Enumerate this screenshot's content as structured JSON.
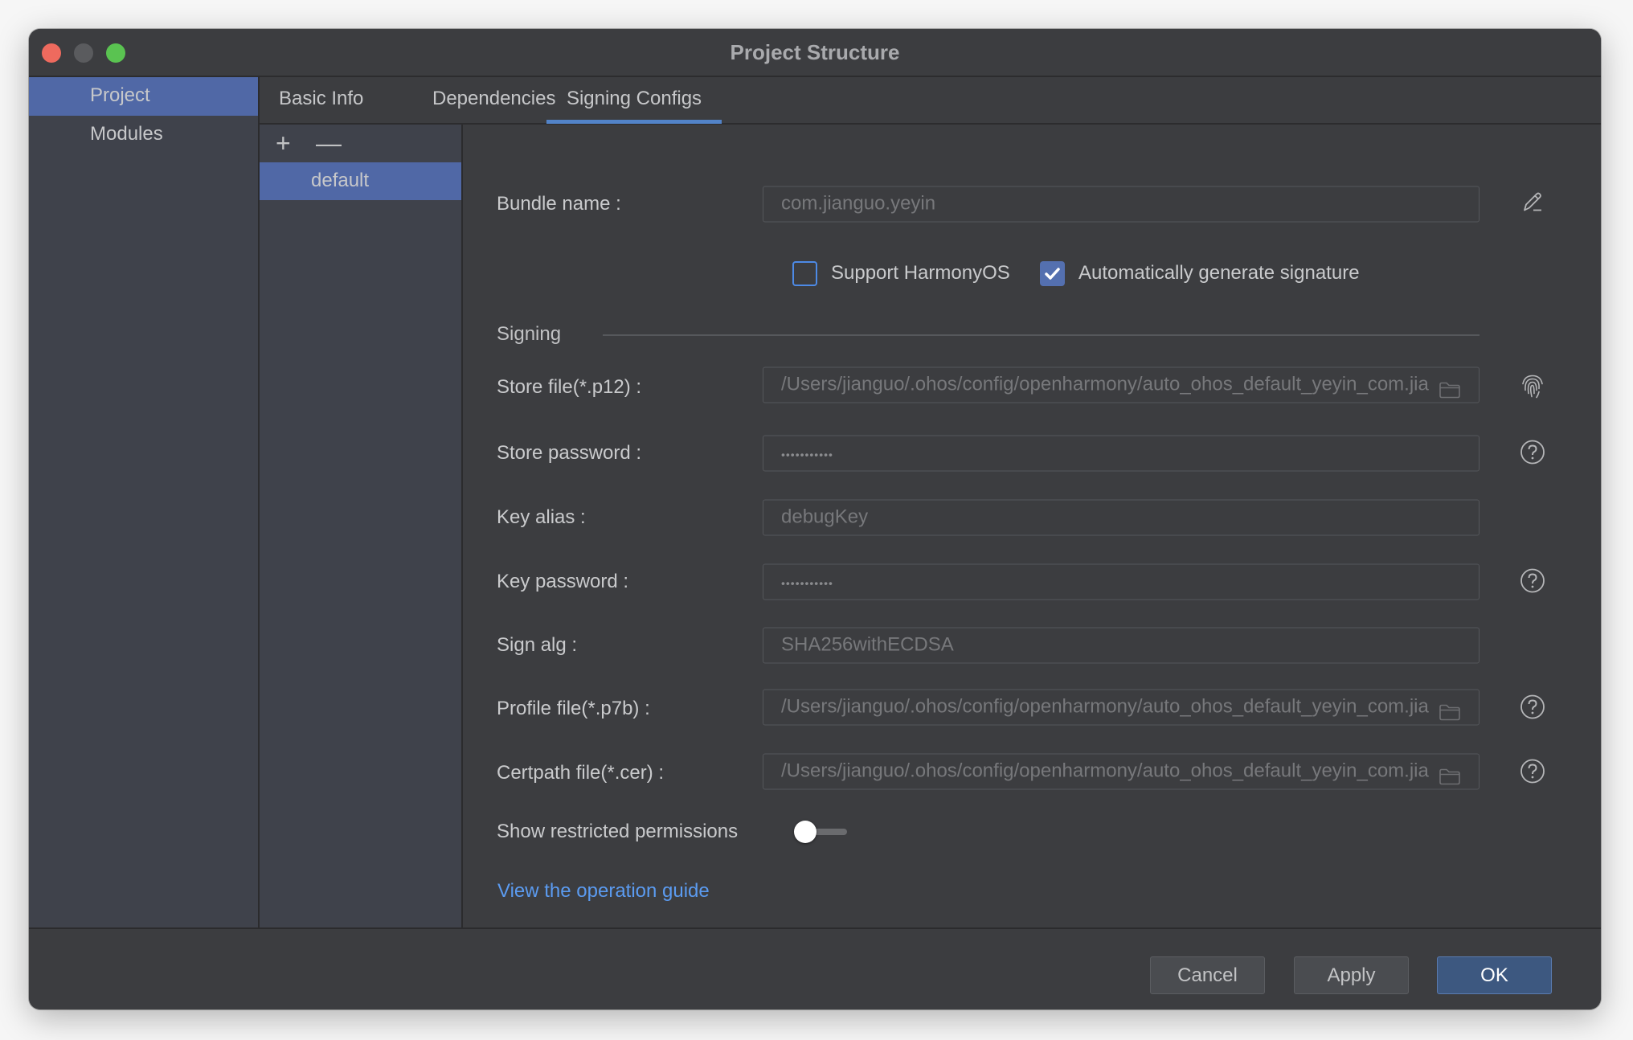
{
  "window": {
    "title": "Project Structure",
    "controls": [
      "close",
      "minimize",
      "maximize"
    ]
  },
  "sidebar": {
    "items": [
      {
        "label": "Project",
        "selected": true
      },
      {
        "label": "Modules",
        "selected": false
      }
    ]
  },
  "tabs": [
    {
      "label": "Basic Info",
      "active": false
    },
    {
      "label": "Dependencies",
      "active": false
    },
    {
      "label": "Signing Configs",
      "active": true
    }
  ],
  "config_list": {
    "add_icon": "plus-icon",
    "remove_icon": "minus-icon",
    "add_glyph": "+",
    "remove_glyph": "—",
    "items": [
      {
        "label": "default",
        "selected": true
      }
    ]
  },
  "form": {
    "bundle_name": {
      "label": "Bundle name :",
      "value": "com.jianguo.yeyin",
      "icon": "pencil-icon"
    },
    "support_harmonyos": {
      "label": "Support HarmonyOS",
      "checked": false
    },
    "auto_generate_signature": {
      "label": "Automatically generate signature",
      "checked": true
    },
    "section_title": "Signing",
    "store_file": {
      "label": "Store file(*.p12) :",
      "value": "/Users/jianguo/.ohos/config/openharmony/auto_ohos_default_yeyin_com.jia",
      "icon": "fingerprint-icon"
    },
    "store_password": {
      "label": "Store password :",
      "value": "•••••••••••",
      "icon": "help-icon"
    },
    "key_alias": {
      "label": "Key alias :",
      "value": "debugKey"
    },
    "key_password": {
      "label": "Key password :",
      "value": "•••••••••••",
      "icon": "help-icon"
    },
    "sign_alg": {
      "label": "Sign alg :",
      "value": "SHA256withECDSA"
    },
    "profile_file": {
      "label": "Profile file(*.p7b) :",
      "value": "/Users/jianguo/.ohos/config/openharmony/auto_ohos_default_yeyin_com.jia",
      "icon": "help-icon"
    },
    "certpath_file": {
      "label": "Certpath file(*.cer) :",
      "value": "/Users/jianguo/.ohos/config/openharmony/auto_ohos_default_yeyin_com.jia",
      "icon": "help-icon"
    },
    "show_restricted_permissions": {
      "label": "Show restricted permissions",
      "enabled": false
    },
    "guide_link": "View the operation guide"
  },
  "footer": {
    "cancel_label": "Cancel",
    "apply_label": "Apply",
    "ok_label": "OK"
  },
  "colors": {
    "accent": "#5068a6",
    "tab_underline": "#5283c8",
    "link": "#5b9bf0",
    "ok_button": "#3d5880"
  }
}
